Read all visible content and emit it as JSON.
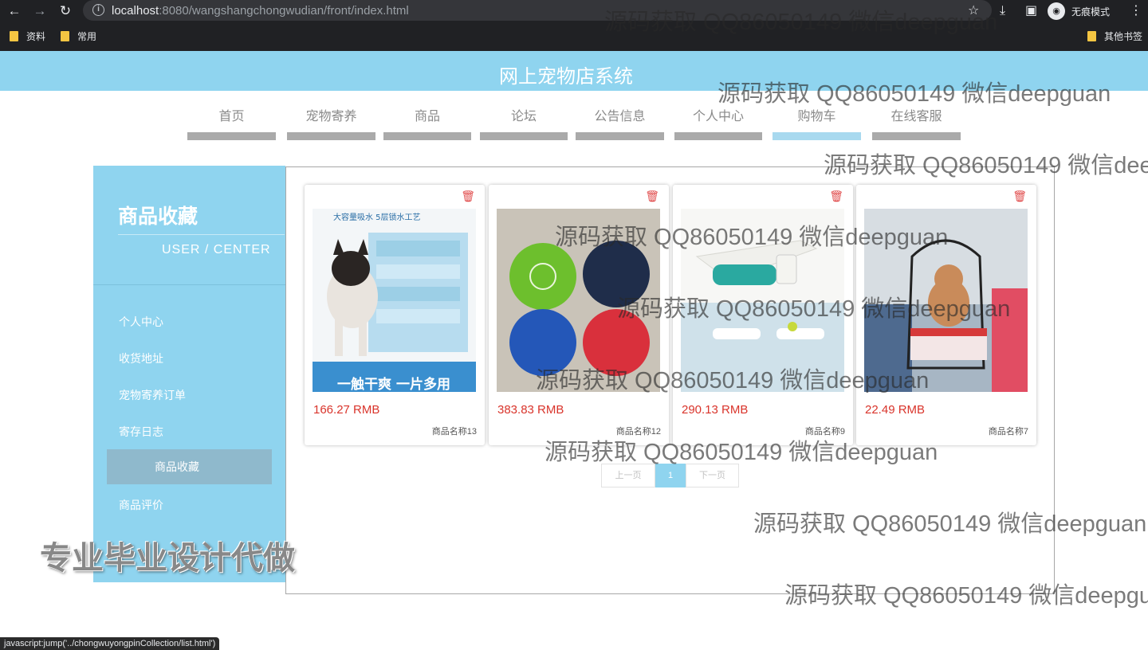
{
  "browser": {
    "url_host": "localhost",
    "url_rest": ":8080/wangshangchongwudian/front/index.html",
    "incognito_label": "无痕模式",
    "bookmarks": [
      "资料",
      "常用"
    ],
    "other_bookmarks": "其他书签"
  },
  "header": {
    "title": "网上宠物店系统"
  },
  "nav": {
    "items": [
      {
        "label": "首页"
      },
      {
        "label": "宠物寄养"
      },
      {
        "label": "商品"
      },
      {
        "label": "论坛"
      },
      {
        "label": "公告信息"
      },
      {
        "label": "个人中心"
      },
      {
        "label": "购物车"
      },
      {
        "label": "在线客服"
      }
    ],
    "active_index": 6
  },
  "sidebar": {
    "title": "商品收藏",
    "subtitle": "USER / CENTER",
    "items": [
      {
        "label": "个人中心"
      },
      {
        "label": "收货地址"
      },
      {
        "label": "宠物寄养订单"
      },
      {
        "label": "寄存日志"
      },
      {
        "label": "商品收藏"
      },
      {
        "label": "商品评价"
      }
    ],
    "active_index": 4
  },
  "products": [
    {
      "price": "166.27 RMB",
      "name": "商品名称13",
      "image_text_top": "大容量吸水\n5层锁水工艺",
      "image_text_bottom": "一触干爽 一片多用"
    },
    {
      "price": "383.83 RMB",
      "name": "商品名称12"
    },
    {
      "price": "290.13 RMB",
      "name": "商品名称9"
    },
    {
      "price": "22.49 RMB",
      "name": "商品名称7"
    }
  ],
  "pagination": {
    "prev": "上一页",
    "current": "1",
    "next": "下一页"
  },
  "watermark_text": "源码获取 QQ86050149 微信deepguan",
  "promo_text": "专业毕业设计代做",
  "status_url": "javascript:jump('../chongwuyongpinCollection/list.html')",
  "colors": {
    "accent": "#8fd4ef",
    "price": "#d9342b"
  }
}
